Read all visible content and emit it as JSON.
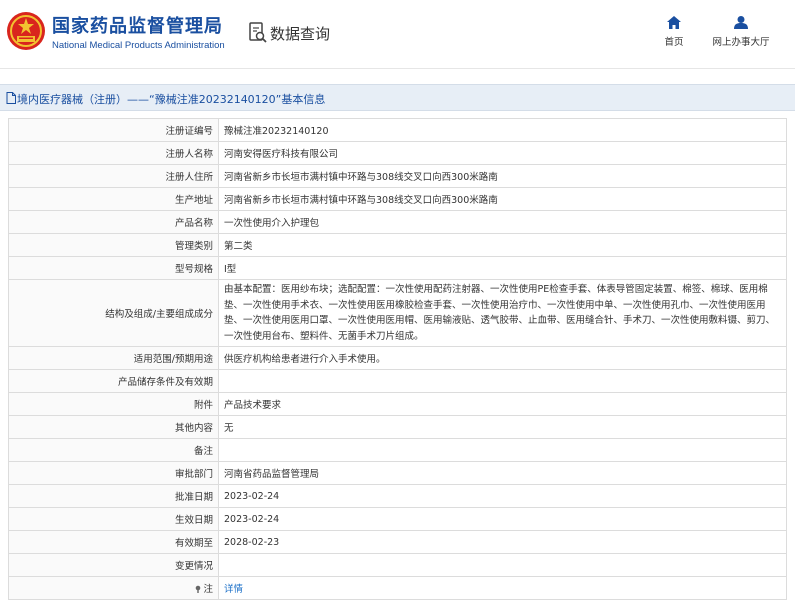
{
  "header": {
    "brand_cn": "国家药品监督管理局",
    "brand_en": "National Medical Products Administration",
    "query_label": "数据查询",
    "nav": [
      {
        "label": "首页",
        "icon": "home-icon"
      },
      {
        "label": "网上办事大厅",
        "icon": "user-icon"
      }
    ]
  },
  "colors": {
    "brand_blue": "#1a4fa0",
    "titlebar_bg": "#e7eef6",
    "link": "#1a6fc8"
  },
  "title_bar": {
    "text": "境内医疗器械（注册）——“豫械注准20232140120”基本信息"
  },
  "fields": [
    {
      "label": "注册证编号",
      "value": "豫械注准20232140120"
    },
    {
      "label": "注册人名称",
      "value": "河南安得医疗科技有限公司"
    },
    {
      "label": "注册人住所",
      "value": "河南省新乡市长垣市满村镇中环路与308线交叉口向西300米路南"
    },
    {
      "label": "生产地址",
      "value": "河南省新乡市长垣市满村镇中环路与308线交叉口向西300米路南"
    },
    {
      "label": "产品名称",
      "value": "一次性使用介入护理包"
    },
    {
      "label": "管理类别",
      "value": "第二类"
    },
    {
      "label": "型号规格",
      "value": "I型"
    },
    {
      "label": "结构及组成/主要组成成分",
      "value": "由基本配置：医用纱布块；选配配置：一次性使用配药注射器、一次性使用PE检查手套、体表导管固定装置、棉签、棉球、医用棉垫、一次性使用手术衣、一次性使用医用橡胶检查手套、一次性使用治疗巾、一次性使用中单、一次性使用孔巾、一次性使用医用垫、一次性使用医用口罩、一次性使用医用帽、医用输液贴、透气胶带、止血带、医用缝合针、手术刀、一次性使用敷料镊、剪刀、一次性使用台布、塑料件、无菌手术刀片组成。"
    },
    {
      "label": "适用范围/预期用途",
      "value": "供医疗机构给患者进行介入手术使用。"
    },
    {
      "label": "产品储存条件及有效期",
      "value": ""
    },
    {
      "label": "附件",
      "value": "产品技术要求"
    },
    {
      "label": "其他内容",
      "value": "无"
    },
    {
      "label": "备注",
      "value": ""
    },
    {
      "label": "审批部门",
      "value": "河南省药品监督管理局"
    },
    {
      "label": "批准日期",
      "value": "2023-02-24"
    },
    {
      "label": "生效日期",
      "value": "2023-02-24"
    },
    {
      "label": "有效期至",
      "value": "2028-02-23"
    },
    {
      "label": "变更情况",
      "value": ""
    },
    {
      "label": "注",
      "value": "详情",
      "icon": "note-icon",
      "link": true
    }
  ]
}
